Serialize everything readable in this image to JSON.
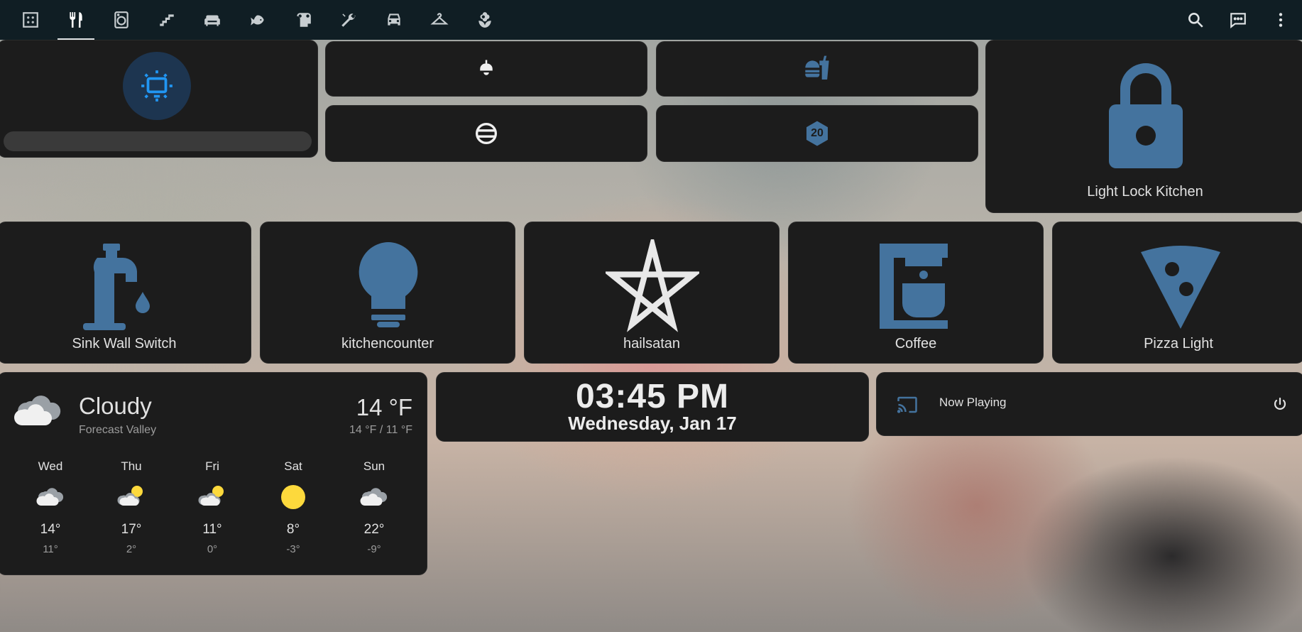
{
  "tabs": [
    {
      "icon": "floorplan-icon",
      "active": false
    },
    {
      "icon": "silverware-icon",
      "active": true
    },
    {
      "icon": "washing-machine-icon",
      "active": false
    },
    {
      "icon": "stairs-icon",
      "active": false
    },
    {
      "icon": "sofa-icon",
      "active": false
    },
    {
      "icon": "fish-icon",
      "active": false
    },
    {
      "icon": "toilet-paper-icon",
      "active": false
    },
    {
      "icon": "wrench-icon",
      "active": false
    },
    {
      "icon": "car-icon",
      "active": false
    },
    {
      "icon": "hanger-icon",
      "active": false
    },
    {
      "icon": "flower-icon",
      "active": false
    }
  ],
  "top_actions": [
    "search-icon",
    "assist-icon",
    "menu-dots-icon"
  ],
  "lock": {
    "label": "Light Lock Kitchen"
  },
  "buttons": [
    {
      "label": "Sink Wall Switch",
      "icon": "faucet-icon"
    },
    {
      "label": "kitchencounter",
      "icon": "lightbulb-icon"
    },
    {
      "label": "hailsatan",
      "icon": "pentagram-icon"
    },
    {
      "label": "Coffee",
      "icon": "coffee-maker-icon"
    },
    {
      "label": "Pizza Light",
      "icon": "pizza-icon"
    }
  ],
  "small_tiles": {
    "badge_number": "20"
  },
  "weather": {
    "state": "Cloudy",
    "location": "Forecast Valley",
    "temperature": "14 °F",
    "hilo": "14 °F / 11 °F",
    "forecast": [
      {
        "day": "Wed",
        "hi": "14°",
        "lo": "11°",
        "icon": "cloudy"
      },
      {
        "day": "Thu",
        "hi": "17°",
        "lo": "2°",
        "icon": "partly-cloudy"
      },
      {
        "day": "Fri",
        "hi": "11°",
        "lo": "0°",
        "icon": "partly-cloudy"
      },
      {
        "day": "Sat",
        "hi": "8°",
        "lo": "-3°",
        "icon": "sunny"
      },
      {
        "day": "Sun",
        "hi": "22°",
        "lo": "-9°",
        "icon": "cloudy"
      }
    ]
  },
  "clock": {
    "time": "03:45 PM",
    "date": "Wednesday, Jan 17"
  },
  "media": {
    "label": "Now Playing"
  },
  "colors": {
    "accent": "#44739e",
    "active_icon": "#2196f3",
    "sun": "#fdd93c",
    "card": "#1c1c1c",
    "topbar": "#101e24"
  }
}
